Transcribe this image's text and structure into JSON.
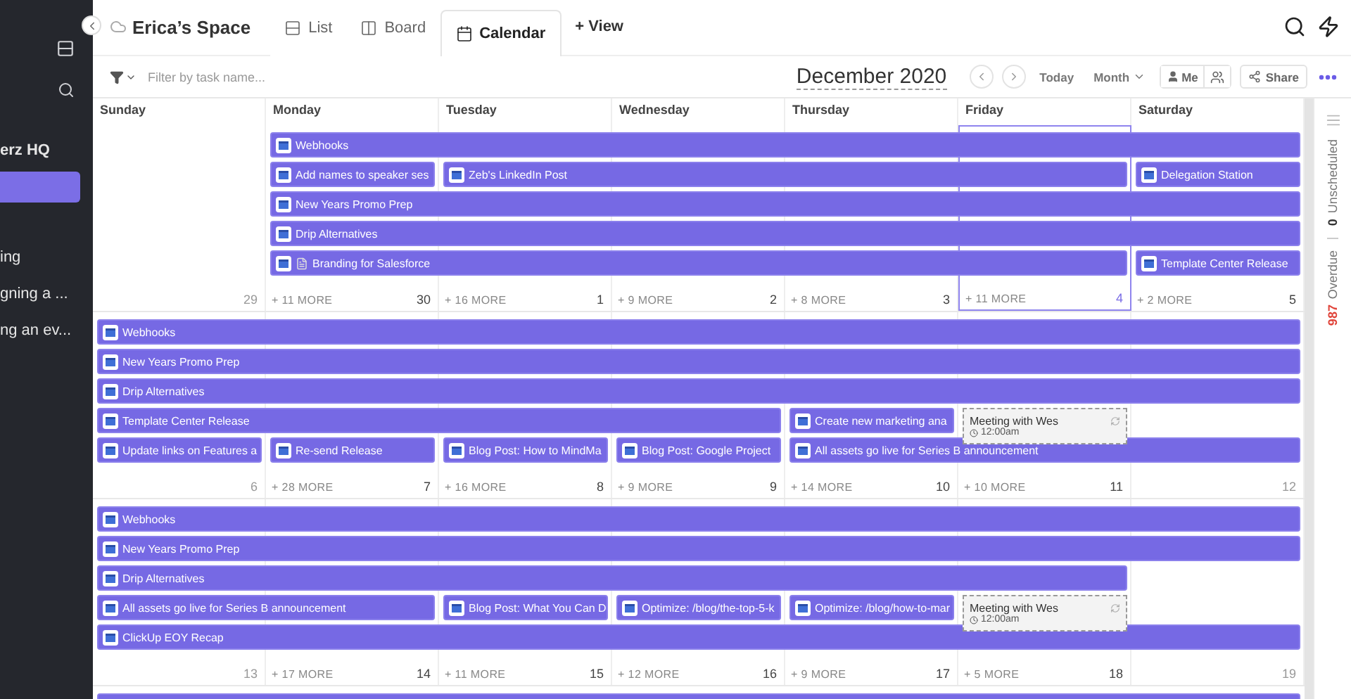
{
  "sidebar": {
    "workspace": "erz HQ",
    "items": [
      {
        "selected": true
      },
      {
        "label": "ing",
        "selected": false
      },
      {
        "label": "gning a ...",
        "selected": false
      },
      {
        "label": "ng an ev...",
        "selected": false
      }
    ]
  },
  "header": {
    "space": "Erica’s Space",
    "tabs": [
      {
        "label": "List",
        "kind": "list",
        "selected": false
      },
      {
        "label": "Board",
        "kind": "board",
        "selected": false
      },
      {
        "label": "Calendar",
        "kind": "calendar",
        "selected": true
      }
    ],
    "add_view": "+ View"
  },
  "toolbar": {
    "filter_placeholder": "Filter by task name...",
    "month": "December 2020",
    "today": "Today",
    "range": "Month",
    "me": "Me",
    "share": "Share"
  },
  "days": [
    "Sunday",
    "Monday",
    "Tuesday",
    "Wednesday",
    "Thursday",
    "Friday",
    "Saturday"
  ],
  "weeks": [
    {
      "days": [
        {
          "date": "29",
          "muted": true,
          "selected": false
        },
        {
          "date": "30",
          "more": "+ 11 MORE",
          "muted": false,
          "selected": false
        },
        {
          "date": "1",
          "more": "+ 16 MORE",
          "muted": false,
          "selected": false
        },
        {
          "date": "2",
          "more": "+ 9 MORE",
          "muted": false,
          "selected": false
        },
        {
          "date": "3",
          "more": "+ 8 MORE",
          "muted": false,
          "selected": false
        },
        {
          "date": "4",
          "more": "+ 11 MORE",
          "muted": false,
          "selected": true
        },
        {
          "date": "5",
          "more": "+ 2 MORE",
          "muted": false,
          "selected": false
        }
      ],
      "lanes": [
        [
          {
            "kind": "empty"
          },
          {
            "kind": "task",
            "title": "Webhooks"
          },
          {
            "kind": "continued"
          },
          {
            "kind": "continued"
          },
          {
            "kind": "continued"
          },
          {
            "kind": "continued"
          },
          {
            "kind": "continued"
          }
        ],
        [
          {
            "kind": "empty"
          },
          {
            "kind": "task",
            "title": "Add names to speaker ses"
          },
          {
            "kind": "task",
            "title": "Zeb's LinkedIn Post"
          },
          {
            "kind": "continued"
          },
          {
            "kind": "continued"
          },
          {
            "kind": "continued"
          },
          {
            "kind": "task",
            "title": "Delegation Station"
          }
        ],
        [
          {
            "kind": "empty"
          },
          {
            "kind": "task",
            "title": "New Years Promo Prep"
          },
          {
            "kind": "continued"
          },
          {
            "kind": "continued"
          },
          {
            "kind": "continued"
          },
          {
            "kind": "continued"
          },
          {
            "kind": "continued"
          }
        ],
        [
          {
            "kind": "empty"
          },
          {
            "kind": "task",
            "title": "Drip Alternatives"
          },
          {
            "kind": "continued"
          },
          {
            "kind": "continued"
          },
          {
            "kind": "continued"
          },
          {
            "kind": "continued"
          },
          {
            "kind": "continued"
          }
        ],
        [
          {
            "kind": "empty"
          },
          {
            "kind": "task",
            "title": "Branding for Salesforce",
            "doc": true
          },
          {
            "kind": "continued"
          },
          {
            "kind": "continued"
          },
          {
            "kind": "continued"
          },
          {
            "kind": "continued"
          },
          {
            "kind": "task",
            "title": "Template Center Release"
          }
        ]
      ]
    },
    {
      "days": [
        {
          "date": "6",
          "muted": true,
          "selected": false
        },
        {
          "date": "7",
          "more": "+ 28 MORE",
          "muted": false,
          "selected": false
        },
        {
          "date": "8",
          "more": "+ 16 MORE",
          "muted": false,
          "selected": false
        },
        {
          "date": "9",
          "more": "+ 9 MORE",
          "muted": false,
          "selected": false
        },
        {
          "date": "10",
          "more": "+ 14 MORE",
          "muted": false,
          "selected": false
        },
        {
          "date": "11",
          "more": "+ 10 MORE",
          "muted": false,
          "selected": false
        },
        {
          "date": "12",
          "muted": true,
          "selected": false
        }
      ],
      "lanes": [
        [
          {
            "kind": "task",
            "title": "Webhooks"
          },
          {
            "kind": "continued"
          },
          {
            "kind": "continued"
          },
          {
            "kind": "continued"
          },
          {
            "kind": "continued"
          },
          {
            "kind": "continued"
          },
          {
            "kind": "continued"
          }
        ],
        [
          {
            "kind": "task",
            "title": "New Years Promo Prep"
          },
          {
            "kind": "continued"
          },
          {
            "kind": "continued"
          },
          {
            "kind": "continued"
          },
          {
            "kind": "continued"
          },
          {
            "kind": "continued"
          },
          {
            "kind": "continued"
          }
        ],
        [
          {
            "kind": "task",
            "title": "Drip Alternatives"
          },
          {
            "kind": "continued"
          },
          {
            "kind": "continued"
          },
          {
            "kind": "continued"
          },
          {
            "kind": "continued"
          },
          {
            "kind": "continued"
          },
          {
            "kind": "continued"
          }
        ],
        [
          {
            "kind": "task",
            "title": "Template Center Release"
          },
          {
            "kind": "continued"
          },
          {
            "kind": "continued"
          },
          {
            "kind": "continued"
          },
          {
            "kind": "task",
            "title": "Create new marketing ana"
          },
          {
            "kind": "meeting",
            "title": "Meeting with Wes",
            "time": "12:00am"
          },
          {
            "kind": "empty"
          }
        ],
        [
          {
            "kind": "task",
            "title": "Update links on Features a"
          },
          {
            "kind": "task",
            "title": "Re-send Release"
          },
          {
            "kind": "task",
            "title": "Blog Post: How to MindMa"
          },
          {
            "kind": "task",
            "title": "Blog Post: Google Project"
          },
          {
            "kind": "task",
            "title": "All assets go live for Series B announcement"
          },
          {
            "kind": "continued"
          },
          {
            "kind": "continued"
          }
        ]
      ]
    },
    {
      "days": [
        {
          "date": "13",
          "muted": true,
          "selected": false
        },
        {
          "date": "14",
          "more": "+ 17 MORE",
          "muted": false,
          "selected": false
        },
        {
          "date": "15",
          "more": "+ 11 MORE",
          "muted": false,
          "selected": false
        },
        {
          "date": "16",
          "more": "+ 12 MORE",
          "muted": false,
          "selected": false
        },
        {
          "date": "17",
          "more": "+ 9 MORE",
          "muted": false,
          "selected": false
        },
        {
          "date": "18",
          "more": "+ 5 MORE",
          "muted": false,
          "selected": false
        },
        {
          "date": "19",
          "muted": true,
          "selected": false
        }
      ],
      "lanes": [
        [
          {
            "kind": "task",
            "title": "Webhooks"
          },
          {
            "kind": "continued"
          },
          {
            "kind": "continued"
          },
          {
            "kind": "continued"
          },
          {
            "kind": "continued"
          },
          {
            "kind": "continued"
          },
          {
            "kind": "continued"
          }
        ],
        [
          {
            "kind": "task",
            "title": "New Years Promo Prep"
          },
          {
            "kind": "continued"
          },
          {
            "kind": "continued"
          },
          {
            "kind": "continued"
          },
          {
            "kind": "continued"
          },
          {
            "kind": "continued"
          },
          {
            "kind": "continued"
          }
        ],
        [
          {
            "kind": "task",
            "title": "Drip Alternatives"
          },
          {
            "kind": "continued"
          },
          {
            "kind": "continued"
          },
          {
            "kind": "continued"
          },
          {
            "kind": "continued"
          },
          {
            "kind": "continued"
          },
          {
            "kind": "empty"
          }
        ],
        [
          {
            "kind": "task",
            "title": "All assets go live for Series B announcement"
          },
          {
            "kind": "continued"
          },
          {
            "kind": "task",
            "title": "Blog Post: What You Can D"
          },
          {
            "kind": "task",
            "title": "Optimize: /blog/the-top-5-k"
          },
          {
            "kind": "task",
            "title": "Optimize: /blog/how-to-mar"
          },
          {
            "kind": "meeting",
            "title": "Meeting with Wes",
            "time": "12:00am"
          },
          {
            "kind": "empty"
          }
        ],
        [
          {
            "kind": "task",
            "title": "ClickUp EOY Recap"
          },
          {
            "kind": "continued"
          },
          {
            "kind": "continued"
          },
          {
            "kind": "continued"
          },
          {
            "kind": "continued"
          },
          {
            "kind": "continued"
          },
          {
            "kind": "continued"
          }
        ]
      ]
    },
    {
      "lanes": [
        [
          {
            "kind": "task"
          },
          {
            "kind": "continued"
          },
          {
            "kind": "continued"
          },
          {
            "kind": "continued"
          },
          {
            "kind": "continued"
          },
          {
            "kind": "continued"
          },
          {
            "kind": "continued"
          }
        ]
      ]
    }
  ],
  "side_panel": {
    "unscheduled_count": "0",
    "unscheduled_label": "Unscheduled",
    "overdue_count": "987",
    "overdue_label": "Overdue"
  }
}
